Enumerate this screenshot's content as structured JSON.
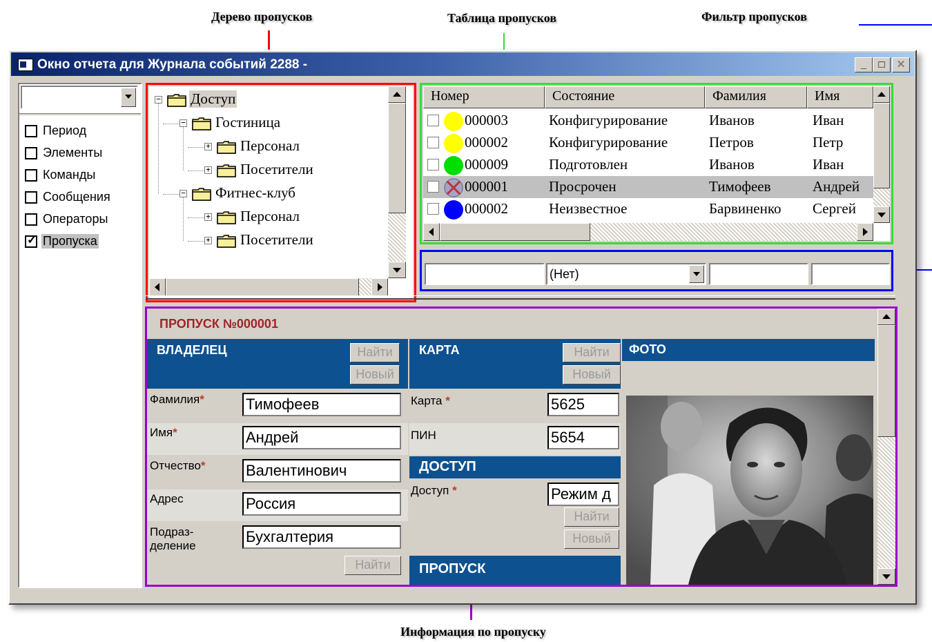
{
  "callouts": {
    "tree": "Дерево пропусков",
    "table": "Таблица пропусков",
    "filter": "Фильтр пропусков",
    "info": "Информация по пропуску"
  },
  "colors": {
    "tree_frame": "#ff0000",
    "table_frame": "#33dd33",
    "filter_frame": "#0000ff",
    "info_frame": "#9900cc",
    "title_bar": "#0a246a",
    "section_header": "#0d5190"
  },
  "window": {
    "title": "Окно отчета для Журнала событий 2288 -",
    "buttons": {
      "minimize": "_",
      "maximize": "□",
      "close": "✕"
    }
  },
  "options": {
    "combo_value": "",
    "items": [
      {
        "label": "Период",
        "checked": false
      },
      {
        "label": "Элементы",
        "checked": false
      },
      {
        "label": "Команды",
        "checked": false
      },
      {
        "label": "Сообщения",
        "checked": false
      },
      {
        "label": "Операторы",
        "checked": false
      },
      {
        "label": "Пропуска",
        "checked": true
      }
    ]
  },
  "tree": {
    "nodes": [
      {
        "label": "Доступ",
        "level": 0,
        "expander": "minus"
      },
      {
        "label": "Гостиница",
        "level": 1,
        "expander": "minus"
      },
      {
        "label": "Персонал",
        "level": 2,
        "expander": "plus"
      },
      {
        "label": "Посетители",
        "level": 2,
        "expander": "plus"
      },
      {
        "label": "Фитнес-клуб",
        "level": 1,
        "expander": "minus"
      },
      {
        "label": "Персонал",
        "level": 2,
        "expander": "plus"
      },
      {
        "label": "Посетители",
        "level": 2,
        "expander": "plus"
      }
    ]
  },
  "table": {
    "columns": [
      "Номер",
      "Состояние",
      "Фамилия",
      "Имя"
    ],
    "rows": [
      {
        "status_color": "#ffff00",
        "number": "000003",
        "state": "Конфигурирование",
        "surname": "Иванов",
        "name": "Иван"
      },
      {
        "status_color": "#ffff00",
        "number": "000002",
        "state": "Конфигурирование",
        "surname": "Петров",
        "name": "Петр"
      },
      {
        "status_color": "#00dd00",
        "number": "000009",
        "state": "Подготовлен",
        "surname": "Иванов",
        "name": "Иван"
      },
      {
        "status_color": "expired-x",
        "number": "000001",
        "state": "Просрочен",
        "surname": "Тимофеев",
        "name": "Андрей"
      },
      {
        "status_color": "#0000ff",
        "number": "000002",
        "state": "Неизвестное",
        "surname": "Барвиненко",
        "name": "Сергей"
      }
    ]
  },
  "filter": {
    "number": "",
    "state": "(Нет)",
    "surname": "",
    "name": ""
  },
  "pass": {
    "title": "ПРОПУСК №000001",
    "owner": {
      "header": "ВЛАДЕЛЕЦ",
      "find": "Найти",
      "new": "Новый",
      "fields": [
        {
          "label": "Фамилия",
          "required": true,
          "value": "Тимофеев"
        },
        {
          "label": "Имя",
          "required": true,
          "value": "Андрей"
        },
        {
          "label": "Отчество",
          "required": true,
          "value": "Валентинович"
        },
        {
          "label": "Адрес",
          "required": false,
          "value": "Россия"
        },
        {
          "label": "Подраз-\nделение",
          "required": false,
          "value": "Бухгалтерия"
        }
      ],
      "dept_find": "Найти"
    },
    "card": {
      "header": "КАРТА",
      "find": "Найти",
      "new": "Новый",
      "card_label": "Карта",
      "card_required": true,
      "card_value": "5625",
      "pin_label": "ПИН",
      "pin_value": "5654"
    },
    "access": {
      "header": "ДОСТУП",
      "label": "Доступ",
      "required": true,
      "value": "Режим д",
      "find": "Найти",
      "new": "Новый"
    },
    "pass_section": {
      "header": "ПРОПУСК"
    },
    "photo": {
      "header": "ФОТО"
    },
    "required_mark": "*"
  }
}
